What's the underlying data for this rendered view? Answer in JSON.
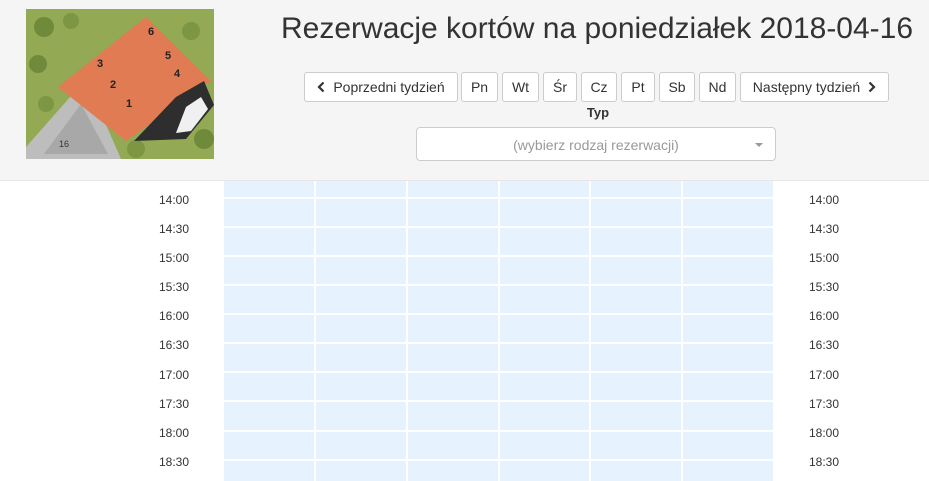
{
  "header": {
    "title": "Rezerwacje kortów na poniedziałek 2018-04-16"
  },
  "logo": {
    "court_numbers": [
      "1",
      "2",
      "3",
      "4",
      "5",
      "6"
    ],
    "court_label": "16"
  },
  "nav": {
    "prev_label": "Poprzedni tydzień",
    "next_label": "Następny tydzień",
    "days": [
      "Pn",
      "Wt",
      "Śr",
      "Cz",
      "Pt",
      "Sb",
      "Nd"
    ]
  },
  "filter": {
    "type_label": "Typ",
    "type_placeholder": "(wybierz rodzaj rezerwacji)"
  },
  "schedule": {
    "times": [
      "14:00",
      "14:30",
      "15:00",
      "15:30",
      "16:00",
      "16:30",
      "17:00",
      "17:30",
      "18:00",
      "18:30"
    ],
    "columns": 6
  },
  "colors": {
    "header_bg": "#f5f5f5",
    "slot_free": "#e6f3ff",
    "roof": "#e07b54"
  }
}
